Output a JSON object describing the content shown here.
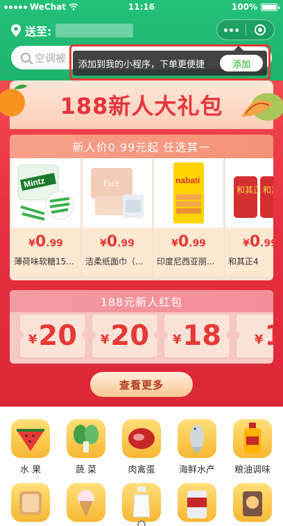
{
  "status_bar": {
    "carrier": "WeChat",
    "time": "11:16",
    "battery": "100%"
  },
  "nav": {
    "deliver_to": "送至:"
  },
  "search": {
    "placeholder": "空调被"
  },
  "tooltip": {
    "text": "添加到我的小程序，下单更便捷",
    "add_label": "添加"
  },
  "banner": {
    "title": "188新人大礼包"
  },
  "new_user_deal": {
    "header": "新人价0.99元起  任选其一",
    "products": [
      {
        "price_symbol": "¥",
        "price_int": "0",
        "price_dec": ".99",
        "name": "薄荷味软糖15...",
        "image_label": "Mintz"
      },
      {
        "price_symbol": "¥",
        "price_int": "0",
        "price_dec": ".99",
        "name": "洁柔纸面巾（...",
        "image_label": "Face"
      },
      {
        "price_symbol": "¥",
        "price_int": "0",
        "price_dec": ".99",
        "name": "印度尼西亚丽...",
        "image_label": "nabati"
      },
      {
        "price_symbol": "¥",
        "price_int": "0",
        "price_dec": ".99",
        "name": "和其正4",
        "image_label": "和其正"
      }
    ]
  },
  "red_packet": {
    "header": "188元新人红包",
    "coupons": [
      {
        "symbol": "¥",
        "amount": "20"
      },
      {
        "symbol": "¥",
        "amount": "20"
      },
      {
        "symbol": "¥",
        "amount": "18"
      },
      {
        "symbol": "¥",
        "amount": "1"
      }
    ]
  },
  "see_more_label": "查看更多",
  "categories": [
    {
      "label": "水 果",
      "icon": "watermelon-icon"
    },
    {
      "label": "蔬 菜",
      "icon": "vegetable-icon"
    },
    {
      "label": "肉禽蛋",
      "icon": "meat-icon"
    },
    {
      "label": "海鲜水产",
      "icon": "fish-icon"
    },
    {
      "label": "粮油调味",
      "icon": "oil-icon"
    },
    {
      "label": "",
      "icon": "bread-icon"
    },
    {
      "label": "",
      "icon": "icecream-icon"
    },
    {
      "label": "",
      "icon": "milk-icon"
    },
    {
      "label": "",
      "icon": "beer-icon"
    },
    {
      "label": "",
      "icon": "snack-icon"
    }
  ],
  "colors": {
    "header_green": "#1eb26d",
    "promo_red": "#e8303f",
    "price_red": "#e53935",
    "add_green": "#1aad19"
  }
}
